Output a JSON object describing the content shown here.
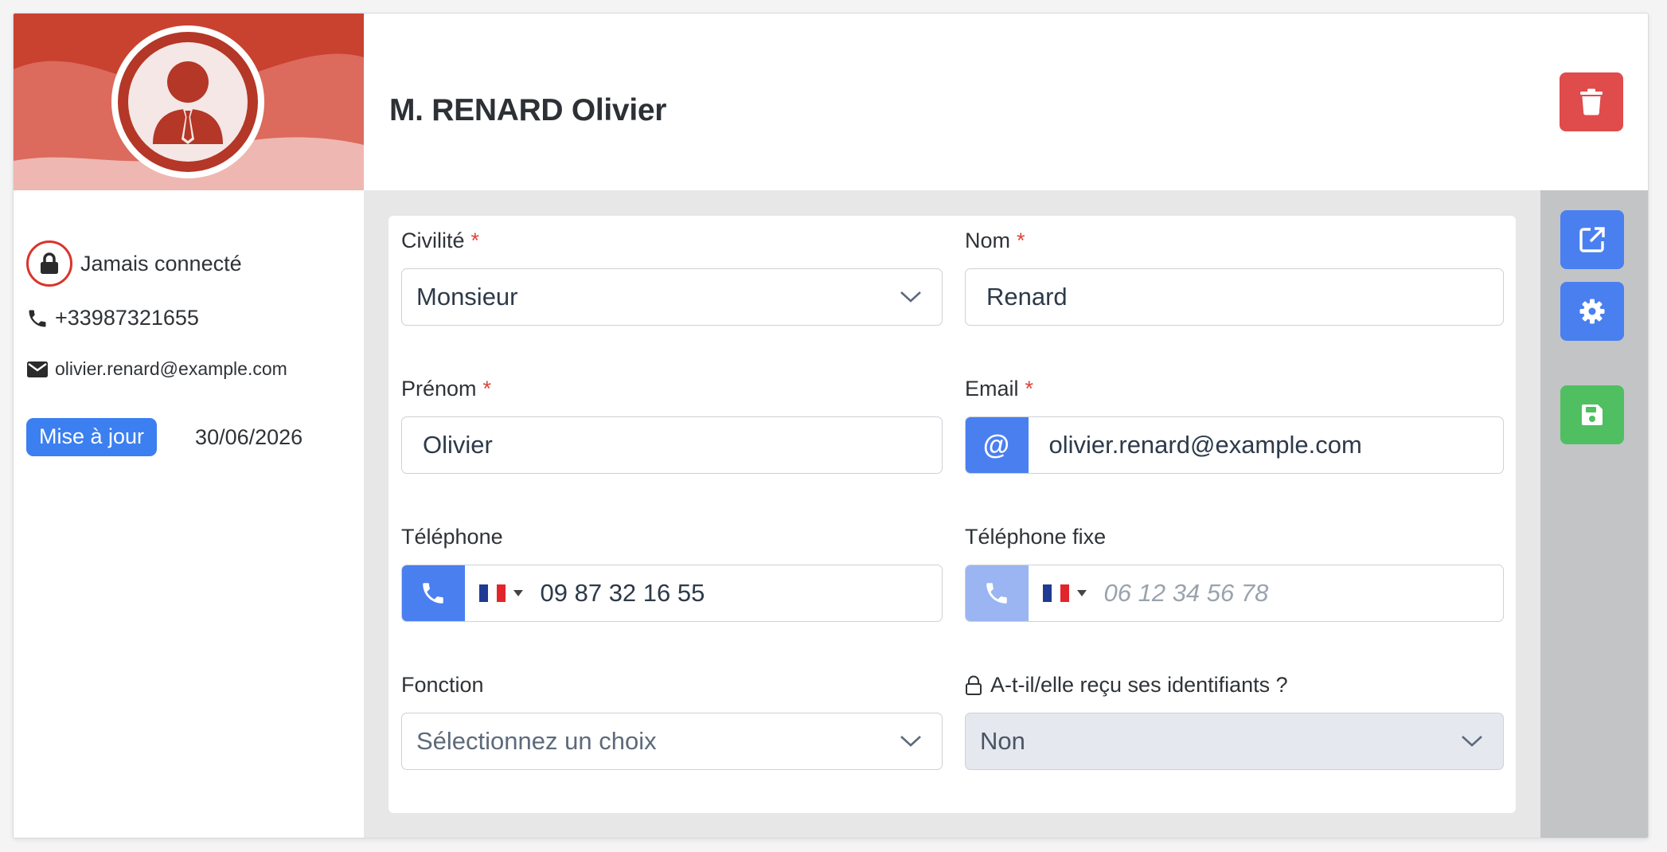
{
  "header": {
    "title": "M. RENARD Olivier"
  },
  "sidebar": {
    "connection_status": "Jamais connecté",
    "phone": "+33987321655",
    "email": "olivier.renard@example.com",
    "update_badge": "Mise à jour",
    "update_date": "30/06/2026"
  },
  "form": {
    "civilite": {
      "label": "Civilité",
      "required": "*",
      "value": "Monsieur"
    },
    "nom": {
      "label": "Nom",
      "required": "*",
      "value": "Renard"
    },
    "prenom": {
      "label": "Prénom",
      "required": "*",
      "value": "Olivier"
    },
    "email": {
      "label": "Email",
      "required": "*",
      "value": "olivier.renard@example.com",
      "prefix_symbol": "@"
    },
    "telephone": {
      "label": "Téléphone",
      "value": "09 87 32 16 55",
      "country_flag": "FR"
    },
    "telephone_fixe": {
      "label": "Téléphone fixe",
      "placeholder": "06 12 34 56 78",
      "country_flag": "FR"
    },
    "fonction": {
      "label": "Fonction",
      "placeholder": "Sélectionnez un choix"
    },
    "identifiants": {
      "label": "A-t-il/elle reçu ses identifiants ?",
      "value": "Non"
    }
  },
  "icons": {
    "delete": "trash-icon",
    "external_link": "external-link-icon",
    "settings": "gear-icon",
    "save": "floppy-disk-icon"
  },
  "colors": {
    "banner_red": "#c9412f",
    "danger": "#e04b4b",
    "primary": "#3b7ff0",
    "side_button_blue": "#4a7ff0",
    "success": "#4fbf61",
    "phone_prefix_active": "#4a7ff0",
    "phone_prefix_disabled": "#9ab5f2",
    "disabled_field": "#e5e8ee"
  }
}
